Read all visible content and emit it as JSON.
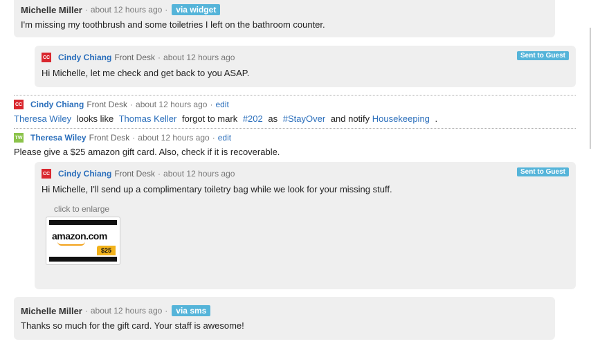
{
  "messages": {
    "guest1": {
      "name": "Michelle Miller",
      "time": "about 12 hours ago",
      "via": "via widget",
      "text": "I'm missing my toothbrush and some toiletries I left on the bathroom counter."
    },
    "reply1": {
      "avatar": "CC",
      "name": "Cindy Chiang",
      "role": "Front Desk",
      "time": "about 12 hours ago",
      "badge": "Sent to Guest",
      "text": "Hi Michelle, let me check and get back to you ASAP."
    },
    "note1": {
      "avatar": "CC",
      "name": "Cindy Chiang",
      "role": "Front Desk",
      "time": "about 12 hours ago",
      "edit": "edit",
      "mention1": "Theresa Wiley",
      "t1": "looks like",
      "mention2": "Thomas Keller",
      "t2": "forgot to mark",
      "tag1": "#202",
      "t3": "as",
      "tag2": "#StayOver",
      "t4": "and notify",
      "mention3": "Housekeeping",
      "t5": "."
    },
    "note2": {
      "avatar": "TW",
      "name": "Theresa Wiley",
      "role": "Front Desk",
      "time": "about 12 hours ago",
      "edit": "edit",
      "text": "Please give a $25 amazon gift card. Also, check if it is recoverable."
    },
    "reply2": {
      "avatar": "CC",
      "name": "Cindy Chiang",
      "role": "Front Desk",
      "time": "about 12 hours ago",
      "badge": "Sent to Guest",
      "text": "Hi Michelle, I'll send up a complimentary toiletry bag while we look for your missing stuff.",
      "enlarge": "click to enlarge",
      "card_logo": "amazon.com",
      "card_amount": "$25"
    },
    "guest2": {
      "name": "Michelle Miller",
      "time": "about 12 hours ago",
      "via": "via sms",
      "text": "Thanks so much for the gift card. Your staff is awesome!"
    }
  },
  "separator": "·",
  "colors": {
    "link": "#2a6ebb",
    "badge": "#55b4d9",
    "avatar_cc": "#d9272e",
    "avatar_tw": "#8bc34a",
    "bubble": "#efefef"
  }
}
